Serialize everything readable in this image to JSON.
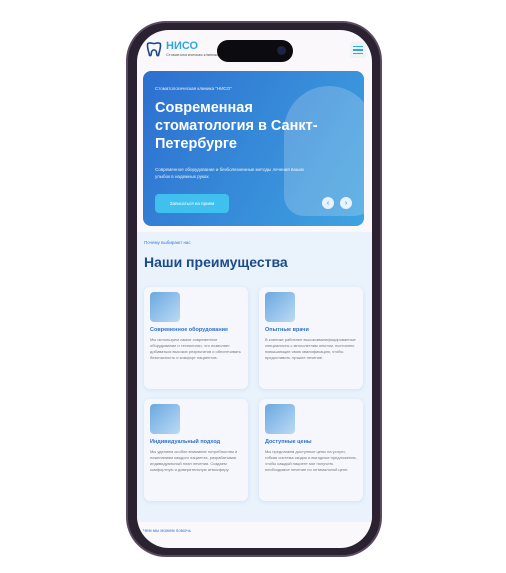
{
  "header": {
    "brand": "НИСО",
    "tagline": "Стоматологическая клиника"
  },
  "hero": {
    "eyebrow": "Стоматологическая клиника \"НИСО\"",
    "title": "Современная стоматология в Санкт-Петербурге",
    "description": "Современное оборудование и безболезненные методы лечения ваших улыбок в надежных руках",
    "cta": "Записаться на прием",
    "prev": "‹",
    "next": "›"
  },
  "advantages": {
    "eyebrow": "Почему выбирают нас",
    "title": "Наши преимущества",
    "cards": [
      {
        "title": "Современное оборудование",
        "text": "Мы используем самое современное оборудование и технологии, что позволяет добиваться высоких результатов и обеспечивать безопасность и комфорт пациентов."
      },
      {
        "title": "Опытные врачи",
        "text": "В клинике работают высококвалифицированные специалисты с многолетним опытом, постоянно повышающие свою квалификацию, чтобы предоставить лучшее лечение."
      },
      {
        "title": "Индивидуальный подход",
        "text": "Мы уделяем особое внимание потребностям и пожеланиям каждого пациента, разрабатывая индивидуальный план лечения. Создаем комфортную и доверительную атмосферу."
      },
      {
        "title": "Доступные цены",
        "text": "Мы предлагаем доступные цены на услуги, гибкая система скидок и выгодные предложения, чтобы каждый пациент мог получить необходимое лечение по оптимальной цене."
      }
    ]
  },
  "footer": {
    "eyebrow": "Чем мы можем помочь"
  }
}
